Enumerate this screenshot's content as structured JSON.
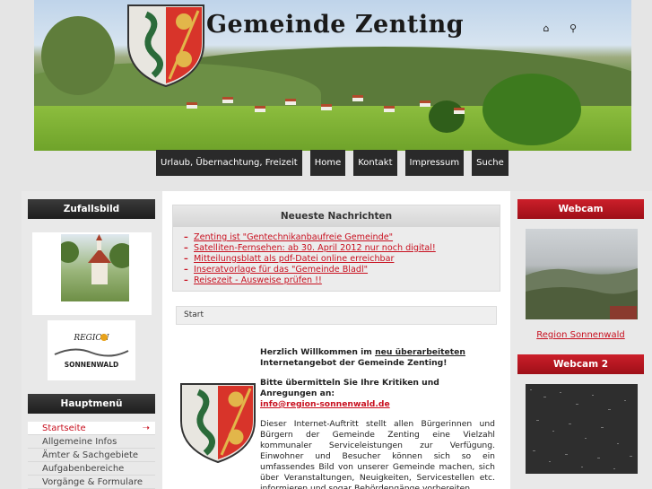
{
  "header": {
    "title": "Gemeinde Zenting",
    "icons": [
      "home-icon",
      "search-icon"
    ]
  },
  "topnav": [
    {
      "label": "Urlaub, Übernachtung, Freizeit"
    },
    {
      "label": "Home"
    },
    {
      "label": "Kontakt"
    },
    {
      "label": "Impressum"
    },
    {
      "label": "Suche"
    }
  ],
  "left": {
    "random_image_title": "Zufallsbild",
    "region_logo_text": "REGION SONNENWALD",
    "menu_title": "Hauptmenü",
    "menu_items": [
      {
        "label": "Startseite",
        "active": true
      },
      {
        "label": "Allgemeine Infos"
      },
      {
        "label": "Ämter & Sachgebiete"
      },
      {
        "label": "Aufgabenbereiche"
      },
      {
        "label": "Vorgänge & Formulare"
      }
    ]
  },
  "center": {
    "news_title": "Neueste Nachrichten",
    "news_items": [
      "Zenting ist \"Gentechnikanbaufreie Gemeinde\"",
      "Satelliten-Fernsehen: ab 30. April 2012 nur noch digital!",
      "Mitteilungsblatt als pdf-Datei online erreichbar",
      "Inseratvorlage für das \"Gemeinde Bladl\"",
      "Reisezeit - Ausweise prüfen !!"
    ],
    "breadcrumb": "Start",
    "welcome_pre": "Herzlich Willkommen im ",
    "welcome_link": "neu überarbeiteten",
    "welcome_post": " Internetangebot der Gemeinde Zenting!",
    "feedback_text": "Bitte übermitteln Sie Ihre Kritiken und Anregungen an:",
    "email": "info@region-sonnenwald.de",
    "body_text": "Dieser Internet-Auftritt stellt allen Bürgerinnen und Bürgern der Gemeinde Zenting eine Vielzahl kommunaler Serviceleistungen zur Verfügung. Einwohner und Besucher können sich so ein umfassendes Bild von unserer Gemeinde machen, sich über Veranstaltungen, Neuigkeiten, Servicestellen etc. informieren und sogar Behördengänge vorbereiten."
  },
  "right": {
    "webcam_title": "Webcam",
    "webcam_label": "Region Sonnenwald",
    "webcam2_title": "Webcam 2"
  },
  "colors": {
    "accent_red": "#c8101f",
    "nav_dark": "#2a2a2a"
  }
}
